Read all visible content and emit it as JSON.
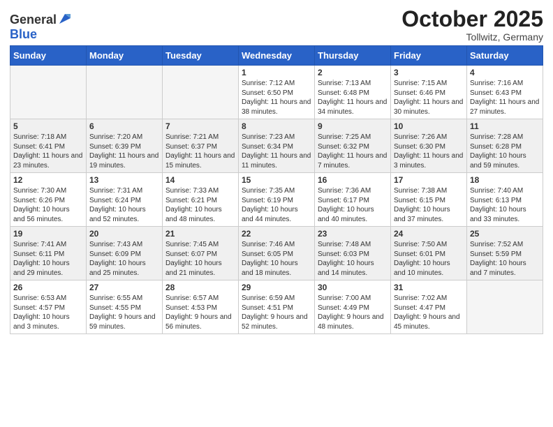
{
  "header": {
    "logo_general": "General",
    "logo_blue": "Blue",
    "month_title": "October 2025",
    "location": "Tollwitz, Germany"
  },
  "weekdays": [
    "Sunday",
    "Monday",
    "Tuesday",
    "Wednesday",
    "Thursday",
    "Friday",
    "Saturday"
  ],
  "weeks": [
    [
      {
        "day": "",
        "info": ""
      },
      {
        "day": "",
        "info": ""
      },
      {
        "day": "",
        "info": ""
      },
      {
        "day": "1",
        "info": "Sunrise: 7:12 AM\nSunset: 6:50 PM\nDaylight: 11 hours\nand 38 minutes."
      },
      {
        "day": "2",
        "info": "Sunrise: 7:13 AM\nSunset: 6:48 PM\nDaylight: 11 hours\nand 34 minutes."
      },
      {
        "day": "3",
        "info": "Sunrise: 7:15 AM\nSunset: 6:46 PM\nDaylight: 11 hours\nand 30 minutes."
      },
      {
        "day": "4",
        "info": "Sunrise: 7:16 AM\nSunset: 6:43 PM\nDaylight: 11 hours\nand 27 minutes."
      }
    ],
    [
      {
        "day": "5",
        "info": "Sunrise: 7:18 AM\nSunset: 6:41 PM\nDaylight: 11 hours\nand 23 minutes."
      },
      {
        "day": "6",
        "info": "Sunrise: 7:20 AM\nSunset: 6:39 PM\nDaylight: 11 hours\nand 19 minutes."
      },
      {
        "day": "7",
        "info": "Sunrise: 7:21 AM\nSunset: 6:37 PM\nDaylight: 11 hours\nand 15 minutes."
      },
      {
        "day": "8",
        "info": "Sunrise: 7:23 AM\nSunset: 6:34 PM\nDaylight: 11 hours\nand 11 minutes."
      },
      {
        "day": "9",
        "info": "Sunrise: 7:25 AM\nSunset: 6:32 PM\nDaylight: 11 hours\nand 7 minutes."
      },
      {
        "day": "10",
        "info": "Sunrise: 7:26 AM\nSunset: 6:30 PM\nDaylight: 11 hours\nand 3 minutes."
      },
      {
        "day": "11",
        "info": "Sunrise: 7:28 AM\nSunset: 6:28 PM\nDaylight: 10 hours\nand 59 minutes."
      }
    ],
    [
      {
        "day": "12",
        "info": "Sunrise: 7:30 AM\nSunset: 6:26 PM\nDaylight: 10 hours\nand 56 minutes."
      },
      {
        "day": "13",
        "info": "Sunrise: 7:31 AM\nSunset: 6:24 PM\nDaylight: 10 hours\nand 52 minutes."
      },
      {
        "day": "14",
        "info": "Sunrise: 7:33 AM\nSunset: 6:21 PM\nDaylight: 10 hours\nand 48 minutes."
      },
      {
        "day": "15",
        "info": "Sunrise: 7:35 AM\nSunset: 6:19 PM\nDaylight: 10 hours\nand 44 minutes."
      },
      {
        "day": "16",
        "info": "Sunrise: 7:36 AM\nSunset: 6:17 PM\nDaylight: 10 hours\nand 40 minutes."
      },
      {
        "day": "17",
        "info": "Sunrise: 7:38 AM\nSunset: 6:15 PM\nDaylight: 10 hours\nand 37 minutes."
      },
      {
        "day": "18",
        "info": "Sunrise: 7:40 AM\nSunset: 6:13 PM\nDaylight: 10 hours\nand 33 minutes."
      }
    ],
    [
      {
        "day": "19",
        "info": "Sunrise: 7:41 AM\nSunset: 6:11 PM\nDaylight: 10 hours\nand 29 minutes."
      },
      {
        "day": "20",
        "info": "Sunrise: 7:43 AM\nSunset: 6:09 PM\nDaylight: 10 hours\nand 25 minutes."
      },
      {
        "day": "21",
        "info": "Sunrise: 7:45 AM\nSunset: 6:07 PM\nDaylight: 10 hours\nand 21 minutes."
      },
      {
        "day": "22",
        "info": "Sunrise: 7:46 AM\nSunset: 6:05 PM\nDaylight: 10 hours\nand 18 minutes."
      },
      {
        "day": "23",
        "info": "Sunrise: 7:48 AM\nSunset: 6:03 PM\nDaylight: 10 hours\nand 14 minutes."
      },
      {
        "day": "24",
        "info": "Sunrise: 7:50 AM\nSunset: 6:01 PM\nDaylight: 10 hours\nand 10 minutes."
      },
      {
        "day": "25",
        "info": "Sunrise: 7:52 AM\nSunset: 5:59 PM\nDaylight: 10 hours\nand 7 minutes."
      }
    ],
    [
      {
        "day": "26",
        "info": "Sunrise: 6:53 AM\nSunset: 4:57 PM\nDaylight: 10 hours\nand 3 minutes."
      },
      {
        "day": "27",
        "info": "Sunrise: 6:55 AM\nSunset: 4:55 PM\nDaylight: 9 hours\nand 59 minutes."
      },
      {
        "day": "28",
        "info": "Sunrise: 6:57 AM\nSunset: 4:53 PM\nDaylight: 9 hours\nand 56 minutes."
      },
      {
        "day": "29",
        "info": "Sunrise: 6:59 AM\nSunset: 4:51 PM\nDaylight: 9 hours\nand 52 minutes."
      },
      {
        "day": "30",
        "info": "Sunrise: 7:00 AM\nSunset: 4:49 PM\nDaylight: 9 hours\nand 48 minutes."
      },
      {
        "day": "31",
        "info": "Sunrise: 7:02 AM\nSunset: 4:47 PM\nDaylight: 9 hours\nand 45 minutes."
      },
      {
        "day": "",
        "info": ""
      }
    ]
  ]
}
